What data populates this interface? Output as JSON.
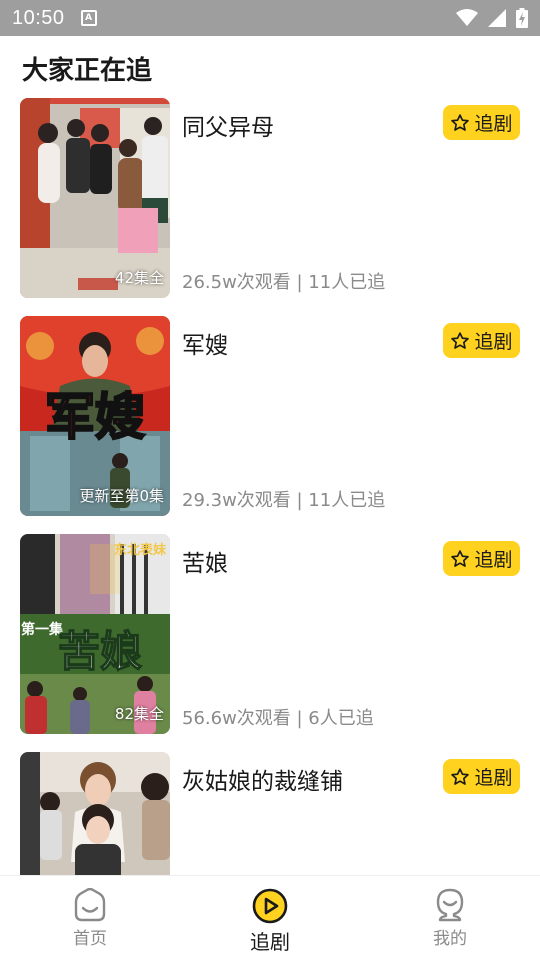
{
  "status_bar": {
    "time": "10:50",
    "notification_icon": "a-box-icon",
    "icons": [
      "wifi-icon",
      "signal-icon",
      "battery-charging-icon"
    ]
  },
  "page": {
    "title": "大家正在追"
  },
  "dramas": [
    {
      "title": "同父异母",
      "badge": "42集全",
      "meta": "26.5w次观看 | 11人已追",
      "follow_label": "追剧"
    },
    {
      "title": "军嫂",
      "badge": "更新至第0集",
      "meta": "29.3w次观看 | 11人已追",
      "follow_label": "追剧"
    },
    {
      "title": "苦娘",
      "badge": "82集全",
      "meta": "56.6w次观看 | 6人已追",
      "follow_label": "追剧"
    },
    {
      "title": "灰姑娘的裁缝铺",
      "badge": "",
      "meta": "",
      "follow_label": "追剧"
    }
  ],
  "thumb_art": {
    "poster_2": "军嫂",
    "poster_3_side": "东北表妹",
    "poster_3_episode": "第一集",
    "poster_3_title": "苦娘"
  },
  "bottom_nav": {
    "items": [
      {
        "label": "首页",
        "icon": "home-icon",
        "active": false
      },
      {
        "label": "追剧",
        "icon": "play-circle-icon",
        "active": true
      },
      {
        "label": "我的",
        "icon": "profile-icon",
        "active": false
      }
    ]
  },
  "colors": {
    "accent": "#ffd21f",
    "status_bar": "#9e9e9e",
    "meta_text": "#8a8a8a"
  }
}
